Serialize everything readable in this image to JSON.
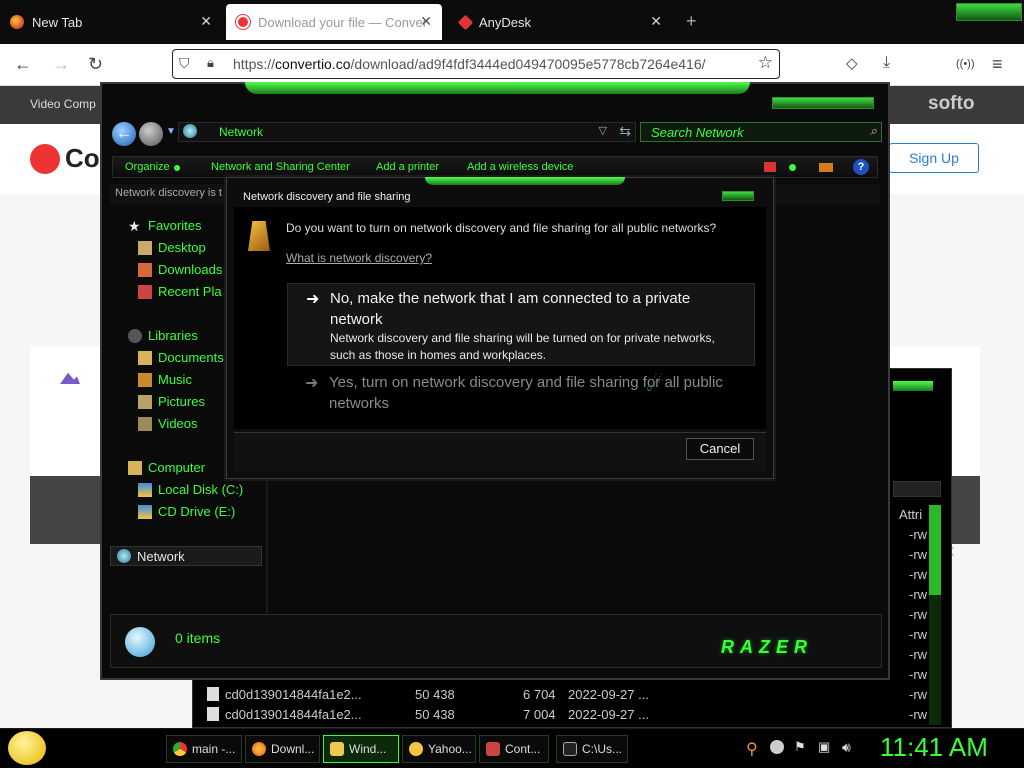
{
  "browser": {
    "tabs": [
      {
        "label": "New Tab",
        "icon": "firefox-icon"
      },
      {
        "label": "Download your file — Convertio",
        "icon": "convertio-icon"
      },
      {
        "label": "AnyDesk",
        "icon": "anydesk-icon"
      }
    ],
    "url_prefix": "https://",
    "url_domain": "convertio.co",
    "url_path": "/download/ad9f4fdf3444ed049470095e5778cb7264e416/"
  },
  "site": {
    "topbar_text": "Video Comp",
    "logo_text": "Co",
    "brand_right": "softo",
    "signup_label": "Sign Up"
  },
  "explorer": {
    "address": "Network",
    "search_placeholder": "Search Network",
    "commands": [
      "Organize",
      "Network and Sharing Center",
      "Add a printer",
      "Add a wireless device"
    ],
    "infobar": "Network discovery is t",
    "nav": {
      "favorites": "Favorites",
      "desktop": "Desktop",
      "downloads": "Downloads",
      "recent": "Recent Pla",
      "libraries": "Libraries",
      "documents": "Documents",
      "music": "Music",
      "pictures": "Pictures",
      "videos": "Videos",
      "computer": "Computer",
      "local_disk": "Local Disk (C:)",
      "cd_drive": "CD Drive (E:)",
      "network": "Network"
    },
    "status_items": "0 items",
    "razer_logo": "RAZER"
  },
  "explorer_back": {
    "column_attr": "Attri",
    "attr_value": "-rw",
    "rows": [
      {
        "name": "cd0d139014844fa1e2...",
        "a": "50 438",
        "b": "6 704",
        "date": "2022-09-27 ..."
      },
      {
        "name": "cd0d139014844fa1e2...",
        "a": "50 438",
        "b": "7 004",
        "date": "2022-09-27 ..."
      }
    ]
  },
  "dialog": {
    "title": "Network discovery and file sharing",
    "question": "Do you want to turn on network discovery and file sharing for all public networks?",
    "link": "What is network discovery?",
    "option1_title": "No, make the network that I am connected to a private network",
    "option1_desc": "Network discovery and file sharing will be turned on for private networks, such as those in homes and workplaces.",
    "option2_title": "Yes, turn on network discovery and file sharing for all public networks",
    "cancel_label": "Cancel"
  },
  "taskbar": {
    "items": [
      "main -...",
      "Downl...",
      "Wind...",
      "Yahoo...",
      "Cont...",
      "C:\\Us..."
    ],
    "clock": "11:41 AM"
  },
  "colors": {
    "accent_green": "#39ff39",
    "dark_bg": "#0a0a0a"
  }
}
